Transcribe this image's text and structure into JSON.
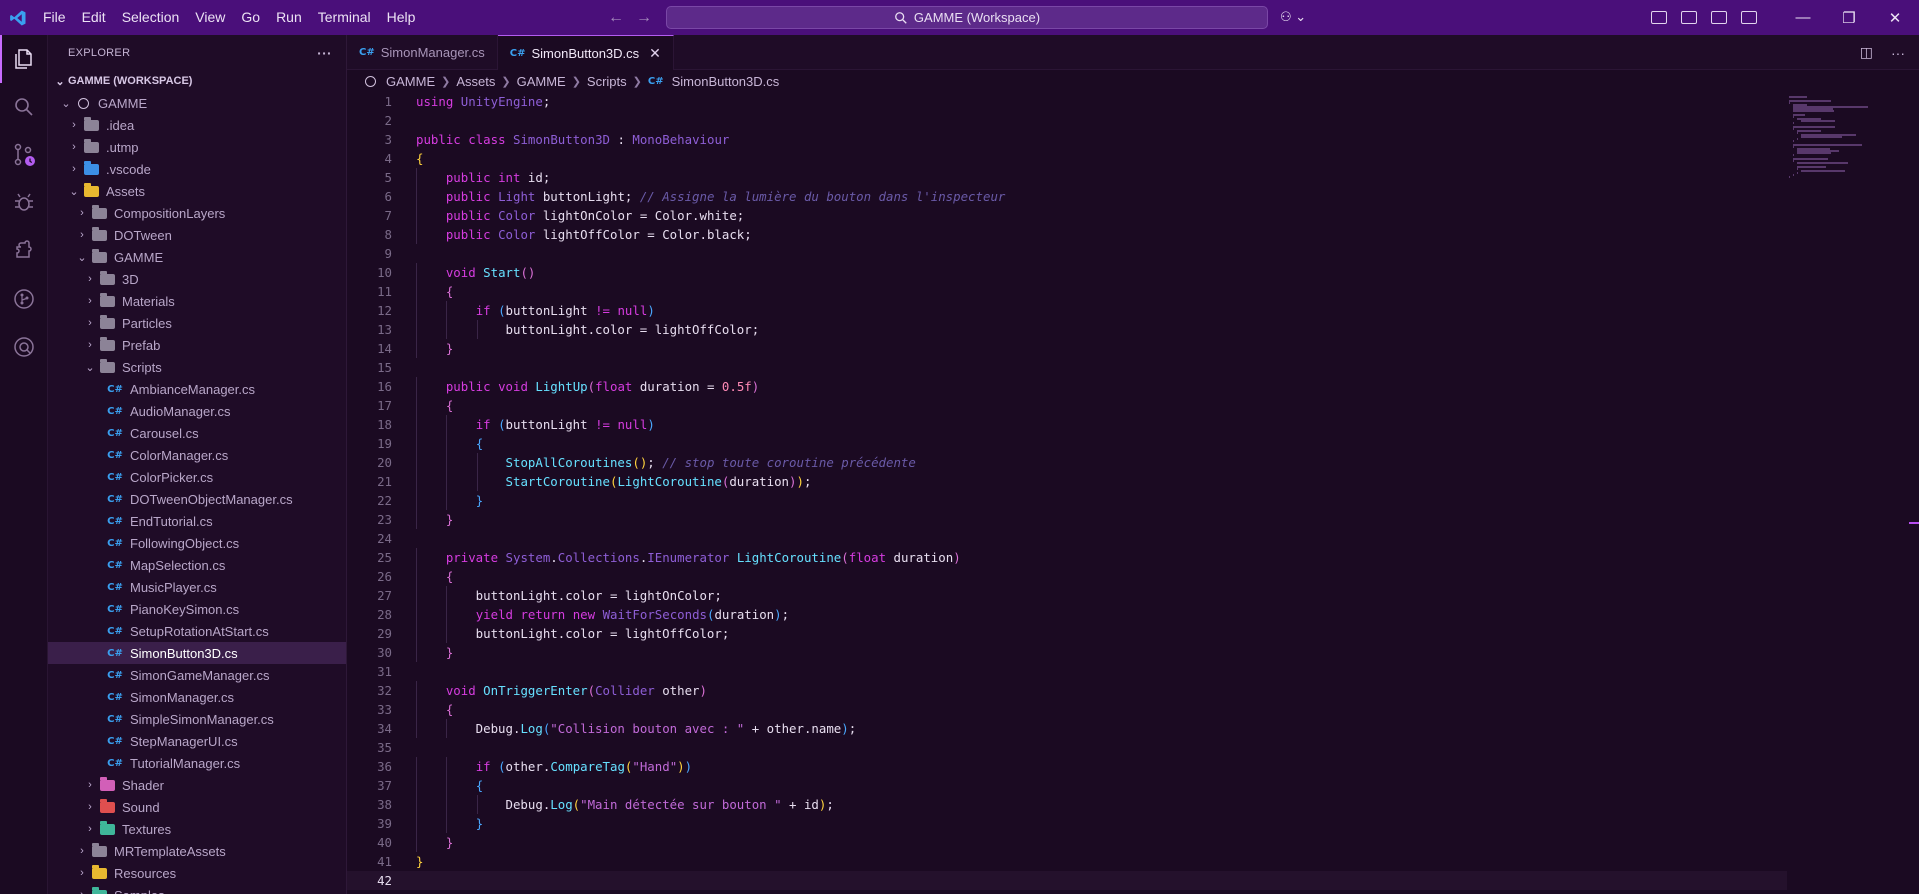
{
  "menu": [
    "File",
    "Edit",
    "Selection",
    "View",
    "Go",
    "Run",
    "Terminal",
    "Help"
  ],
  "search": {
    "label": "GAMME (Workspace)"
  },
  "sidebar": {
    "title": "EXPLORER",
    "more": "···",
    "workspace": "GAMME (WORKSPACE)",
    "items": [
      {
        "label": "GAMME",
        "depth": 0,
        "chev": "⌄",
        "icon": "ring"
      },
      {
        "label": ".idea",
        "depth": 1,
        "chev": "›",
        "icon": "folder"
      },
      {
        "label": ".utmp",
        "depth": 1,
        "chev": "›",
        "icon": "folder"
      },
      {
        "label": ".vscode",
        "depth": 1,
        "chev": "›",
        "icon": "folder blue"
      },
      {
        "label": "Assets",
        "depth": 1,
        "chev": "⌄",
        "icon": "folder yellow"
      },
      {
        "label": "CompositionLayers",
        "depth": 2,
        "chev": "›",
        "icon": "folder"
      },
      {
        "label": "DOTween",
        "depth": 2,
        "chev": "›",
        "icon": "folder"
      },
      {
        "label": "GAMME",
        "depth": 2,
        "chev": "⌄",
        "icon": "folder"
      },
      {
        "label": "3D",
        "depth": 3,
        "chev": "›",
        "icon": "folder"
      },
      {
        "label": "Materials",
        "depth": 3,
        "chev": "›",
        "icon": "folder"
      },
      {
        "label": "Particles",
        "depth": 3,
        "chev": "›",
        "icon": "folder"
      },
      {
        "label": "Prefab",
        "depth": 3,
        "chev": "›",
        "icon": "folder"
      },
      {
        "label": "Scripts",
        "depth": 3,
        "chev": "⌄",
        "icon": "folder"
      },
      {
        "label": "AmbianceManager.cs",
        "depth": 4,
        "chev": "",
        "icon": "cs"
      },
      {
        "label": "AudioManager.cs",
        "depth": 4,
        "chev": "",
        "icon": "cs"
      },
      {
        "label": "Carousel.cs",
        "depth": 4,
        "chev": "",
        "icon": "cs"
      },
      {
        "label": "ColorManager.cs",
        "depth": 4,
        "chev": "",
        "icon": "cs"
      },
      {
        "label": "ColorPicker.cs",
        "depth": 4,
        "chev": "",
        "icon": "cs"
      },
      {
        "label": "DOTweenObjectManager.cs",
        "depth": 4,
        "chev": "",
        "icon": "cs"
      },
      {
        "label": "EndTutorial.cs",
        "depth": 4,
        "chev": "",
        "icon": "cs"
      },
      {
        "label": "FollowingObject.cs",
        "depth": 4,
        "chev": "",
        "icon": "cs"
      },
      {
        "label": "MapSelection.cs",
        "depth": 4,
        "chev": "",
        "icon": "cs"
      },
      {
        "label": "MusicPlayer.cs",
        "depth": 4,
        "chev": "",
        "icon": "cs"
      },
      {
        "label": "PianoKeySimon.cs",
        "depth": 4,
        "chev": "",
        "icon": "cs"
      },
      {
        "label": "SetupRotationAtStart.cs",
        "depth": 4,
        "chev": "",
        "icon": "cs"
      },
      {
        "label": "SimonButton3D.cs",
        "depth": 4,
        "chev": "",
        "icon": "cs",
        "selected": true
      },
      {
        "label": "SimonGameManager.cs",
        "depth": 4,
        "chev": "",
        "icon": "cs"
      },
      {
        "label": "SimonManager.cs",
        "depth": 4,
        "chev": "",
        "icon": "cs"
      },
      {
        "label": "SimpleSimonManager.cs",
        "depth": 4,
        "chev": "",
        "icon": "cs"
      },
      {
        "label": "StepManagerUI.cs",
        "depth": 4,
        "chev": "",
        "icon": "cs"
      },
      {
        "label": "TutorialManager.cs",
        "depth": 4,
        "chev": "",
        "icon": "cs"
      },
      {
        "label": "Shader",
        "depth": 3,
        "chev": "›",
        "icon": "folder pink"
      },
      {
        "label": "Sound",
        "depth": 3,
        "chev": "›",
        "icon": "folder red"
      },
      {
        "label": "Textures",
        "depth": 3,
        "chev": "›",
        "icon": "folder teal"
      },
      {
        "label": "MRTemplateAssets",
        "depth": 2,
        "chev": "›",
        "icon": "folder"
      },
      {
        "label": "Resources",
        "depth": 2,
        "chev": "›",
        "icon": "folder yellow"
      },
      {
        "label": "Samples",
        "depth": 2,
        "chev": "›",
        "icon": "folder teal"
      }
    ]
  },
  "tabs": [
    {
      "label": "SimonManager.cs",
      "active": false
    },
    {
      "label": "SimonButton3D.cs",
      "active": true
    }
  ],
  "breadcrumb": [
    "GAMME",
    "Assets",
    "GAMME",
    "Scripts",
    "SimonButton3D.cs"
  ],
  "code": {
    "current_line": 42,
    "lines": [
      [
        [
          "kw",
          "using"
        ],
        [
          "id",
          " "
        ],
        [
          "ty",
          "UnityEngine"
        ],
        [
          "id",
          ";"
        ]
      ],
      [],
      [
        [
          "kw",
          "public"
        ],
        [
          "id",
          " "
        ],
        [
          "kw",
          "class"
        ],
        [
          "id",
          " "
        ],
        [
          "ty",
          "SimonButton3D"
        ],
        [
          "id",
          " : "
        ],
        [
          "ty",
          "MonoBehaviour"
        ]
      ],
      [
        [
          "p1",
          "{"
        ]
      ],
      [
        [
          "id",
          "    "
        ],
        [
          "kw",
          "public"
        ],
        [
          "id",
          " "
        ],
        [
          "kw",
          "int"
        ],
        [
          "id",
          " id;"
        ]
      ],
      [
        [
          "id",
          "    "
        ],
        [
          "kw",
          "public"
        ],
        [
          "id",
          " "
        ],
        [
          "ty",
          "Light"
        ],
        [
          "id",
          " buttonLight; "
        ],
        [
          "cm",
          "// Assigne la lumière du bouton dans l'inspecteur"
        ]
      ],
      [
        [
          "id",
          "    "
        ],
        [
          "kw",
          "public"
        ],
        [
          "id",
          " "
        ],
        [
          "ty",
          "Color"
        ],
        [
          "id",
          " lightOnColor = Color.white;"
        ]
      ],
      [
        [
          "id",
          "    "
        ],
        [
          "kw",
          "public"
        ],
        [
          "id",
          " "
        ],
        [
          "ty",
          "Color"
        ],
        [
          "id",
          " lightOffColor = Color.black;"
        ]
      ],
      [],
      [
        [
          "id",
          "    "
        ],
        [
          "kw",
          "void"
        ],
        [
          "id",
          " "
        ],
        [
          "fn",
          "Start"
        ],
        [
          "p2",
          "()"
        ]
      ],
      [
        [
          "id",
          "    "
        ],
        [
          "p2",
          "{"
        ]
      ],
      [
        [
          "id",
          "        "
        ],
        [
          "kw",
          "if"
        ],
        [
          "id",
          " "
        ],
        [
          "p3",
          "("
        ],
        [
          "id",
          "buttonLight "
        ],
        [
          "kw",
          "!="
        ],
        [
          "id",
          " "
        ],
        [
          "kw",
          "null"
        ],
        [
          "p3",
          ")"
        ]
      ],
      [
        [
          "id",
          "            buttonLight.color = lightOffColor;"
        ]
      ],
      [
        [
          "id",
          "    "
        ],
        [
          "p2",
          "}"
        ]
      ],
      [],
      [
        [
          "id",
          "    "
        ],
        [
          "kw",
          "public"
        ],
        [
          "id",
          " "
        ],
        [
          "kw",
          "void"
        ],
        [
          "id",
          " "
        ],
        [
          "fn",
          "LightUp"
        ],
        [
          "p2",
          "("
        ],
        [
          "kw",
          "float"
        ],
        [
          "id",
          " duration = "
        ],
        [
          "num",
          "0.5f"
        ],
        [
          "p2",
          ")"
        ]
      ],
      [
        [
          "id",
          "    "
        ],
        [
          "p2",
          "{"
        ]
      ],
      [
        [
          "id",
          "        "
        ],
        [
          "kw",
          "if"
        ],
        [
          "id",
          " "
        ],
        [
          "p3",
          "("
        ],
        [
          "id",
          "buttonLight "
        ],
        [
          "kw",
          "!="
        ],
        [
          "id",
          " "
        ],
        [
          "kw",
          "null"
        ],
        [
          "p3",
          ")"
        ]
      ],
      [
        [
          "id",
          "        "
        ],
        [
          "p3",
          "{"
        ]
      ],
      [
        [
          "id",
          "            "
        ],
        [
          "fn",
          "StopAllCoroutines"
        ],
        [
          "p1",
          "()"
        ],
        [
          "id",
          "; "
        ],
        [
          "cm",
          "// stop toute coroutine précédente"
        ]
      ],
      [
        [
          "id",
          "            "
        ],
        [
          "fn",
          "StartCoroutine"
        ],
        [
          "p1",
          "("
        ],
        [
          "fn",
          "LightCoroutine"
        ],
        [
          "p2",
          "("
        ],
        [
          "id",
          "duration"
        ],
        [
          "p2",
          ")"
        ],
        [
          "p1",
          ")"
        ],
        [
          "id",
          ";"
        ]
      ],
      [
        [
          "id",
          "        "
        ],
        [
          "p3",
          "}"
        ]
      ],
      [
        [
          "id",
          "    "
        ],
        [
          "p2",
          "}"
        ]
      ],
      [],
      [
        [
          "id",
          "    "
        ],
        [
          "kw",
          "private"
        ],
        [
          "id",
          " "
        ],
        [
          "ty",
          "System"
        ],
        [
          "id",
          "."
        ],
        [
          "ty",
          "Collections"
        ],
        [
          "id",
          "."
        ],
        [
          "ty",
          "IEnumerator"
        ],
        [
          "id",
          " "
        ],
        [
          "fn",
          "LightCoroutine"
        ],
        [
          "p2",
          "("
        ],
        [
          "kw",
          "float"
        ],
        [
          "id",
          " duration"
        ],
        [
          "p2",
          ")"
        ]
      ],
      [
        [
          "id",
          "    "
        ],
        [
          "p2",
          "{"
        ]
      ],
      [
        [
          "id",
          "        buttonLight.color = lightOnColor;"
        ]
      ],
      [
        [
          "id",
          "        "
        ],
        [
          "kw",
          "yield"
        ],
        [
          "id",
          " "
        ],
        [
          "kw",
          "return"
        ],
        [
          "id",
          " "
        ],
        [
          "kw",
          "new"
        ],
        [
          "id",
          " "
        ],
        [
          "ty",
          "WaitForSeconds"
        ],
        [
          "p3",
          "("
        ],
        [
          "id",
          "duration"
        ],
        [
          "p3",
          ")"
        ],
        [
          "id",
          ";"
        ]
      ],
      [
        [
          "id",
          "        buttonLight.color = lightOffColor;"
        ]
      ],
      [
        [
          "id",
          "    "
        ],
        [
          "p2",
          "}"
        ]
      ],
      [],
      [
        [
          "id",
          "    "
        ],
        [
          "kw",
          "void"
        ],
        [
          "id",
          " "
        ],
        [
          "fn",
          "OnTriggerEnter"
        ],
        [
          "p2",
          "("
        ],
        [
          "ty",
          "Collider"
        ],
        [
          "id",
          " other"
        ],
        [
          "p2",
          ")"
        ]
      ],
      [
        [
          "id",
          "    "
        ],
        [
          "p2",
          "{"
        ]
      ],
      [
        [
          "id",
          "        Debug."
        ],
        [
          "fn",
          "Log"
        ],
        [
          "p3",
          "("
        ],
        [
          "str",
          "\"Collision bouton avec : \""
        ],
        [
          "id",
          " + other.name"
        ],
        [
          "p3",
          ")"
        ],
        [
          "id",
          ";"
        ]
      ],
      [],
      [
        [
          "id",
          "        "
        ],
        [
          "kw",
          "if"
        ],
        [
          "id",
          " "
        ],
        [
          "p3",
          "("
        ],
        [
          "id",
          "other."
        ],
        [
          "fn",
          "CompareTag"
        ],
        [
          "p1",
          "("
        ],
        [
          "str",
          "\"Hand\""
        ],
        [
          "p1",
          ")"
        ],
        [
          "p3",
          ")"
        ]
      ],
      [
        [
          "id",
          "        "
        ],
        [
          "p3",
          "{"
        ]
      ],
      [
        [
          "id",
          "            Debug."
        ],
        [
          "fn",
          "Log"
        ],
        [
          "p1",
          "("
        ],
        [
          "str",
          "\"Main détectée sur bouton \""
        ],
        [
          "id",
          " + id"
        ],
        [
          "p1",
          ")"
        ],
        [
          "id",
          ";"
        ]
      ],
      [
        [
          "id",
          "        "
        ],
        [
          "p3",
          "}"
        ]
      ],
      [
        [
          "id",
          "    "
        ],
        [
          "p2",
          "}"
        ]
      ],
      [
        [
          "p1",
          "}"
        ]
      ],
      []
    ]
  },
  "colors": {
    "titlebar": "#4a0f7a",
    "editor_bg": "#1b0a22",
    "sidebar_bg": "#1f0c27",
    "accent": "#b35cf0"
  }
}
